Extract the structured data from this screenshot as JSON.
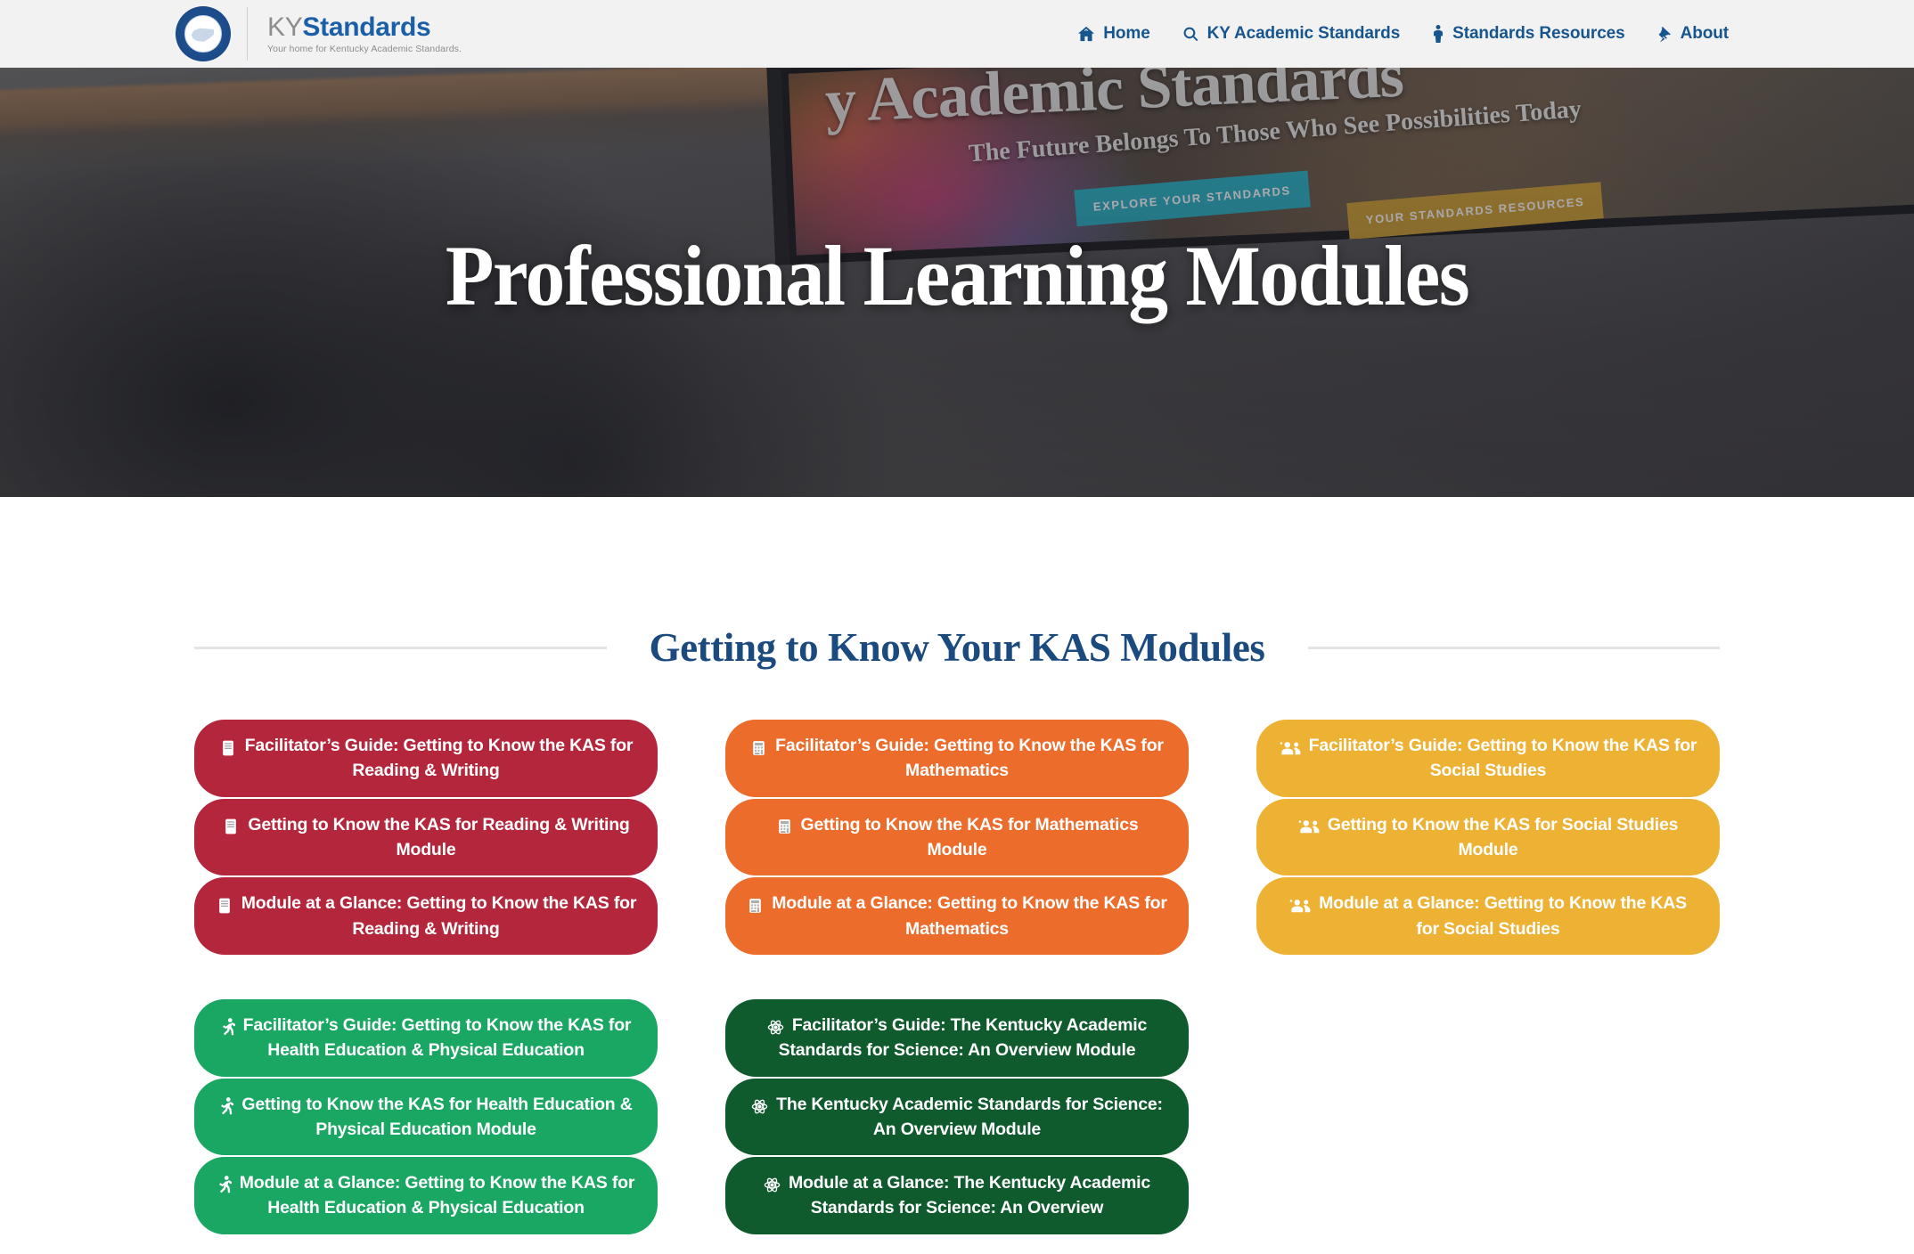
{
  "header": {
    "logo": {
      "seal_alt": "kentucky-department-of-education-seal",
      "title_light": "KY",
      "title_bold": "Standards",
      "tagline": "Your home for Kentucky Academic Standards."
    },
    "nav": [
      {
        "label": "Home",
        "icon": "home-icon"
      },
      {
        "label": "KY Academic Standards",
        "icon": "search-icon"
      },
      {
        "label": "Standards Resources",
        "icon": "person-icon"
      },
      {
        "label": "About",
        "icon": "thumbtack-icon"
      }
    ],
    "nav_color": "#17558f",
    "background": "#f2f2f2"
  },
  "hero": {
    "title": "Professional Learning Modules",
    "background_photo": "classroom-desk-with-monitor-showing-ky-academic-standards-site",
    "screen": {
      "headline": "y Academic Standards",
      "subhead": "The Future Belongs To Those Who See Possibilities Today",
      "button_primary": "EXPLORE YOUR STANDARDS",
      "button_secondary": "YOUR STANDARDS RESOURCES",
      "primary_color": "#28b0c4",
      "secondary_color": "#cfa033"
    }
  },
  "section": {
    "heading": "Getting to Know Your KAS Modules",
    "heading_color": "#1b4a7e",
    "rule_color": "#e4e4e4"
  },
  "module_groups": [
    {
      "subject": "Reading & Writing",
      "color": "#b4263c",
      "icon": "book-reader-icon",
      "buttons": [
        "Facilitator’s Guide: Getting to Know the KAS for Reading & Writing",
        "Getting to Know the KAS for Reading & Writing Module",
        "Module at a Glance: Getting to Know the KAS for Reading & Writing"
      ]
    },
    {
      "subject": "Mathematics",
      "color": "#ec6c2c",
      "icon": "calculator-icon",
      "buttons": [
        "Facilitator’s Guide: Getting to Know the KAS for Mathematics",
        "Getting to Know the KAS for Mathematics Module",
        "Module at a Glance: Getting to Know the KAS for Mathematics"
      ]
    },
    {
      "subject": "Social Studies",
      "color": "#edb134",
      "icon": "users-icon",
      "buttons": [
        "Facilitator’s Guide: Getting to Know the KAS for Social Studies",
        "Getting to Know the KAS for Social Studies Module",
        "Module at a Glance: Getting to Know the KAS for Social Studies"
      ]
    },
    {
      "subject": "Health Education & Physical Education",
      "color": "#1aa663",
      "icon": "running-icon",
      "buttons": [
        "Facilitator’s Guide: Getting to Know the KAS for Health Education & Physical Education",
        "Getting to Know the KAS for Health Education & Physical Education Module",
        "Module at a Glance: Getting to Know the KAS for Health Education & Physical Education"
      ]
    },
    {
      "subject": "Science",
      "color": "#0f5b2e",
      "icon": "atom-icon",
      "buttons": [
        "Facilitator’s Guide: The Kentucky Academic Standards for Science: An Overview Module",
        "The Kentucky Academic Standards for Science: An Overview Module",
        "Module at a Glance: The Kentucky Academic Standards for Science: An Overview"
      ]
    }
  ]
}
